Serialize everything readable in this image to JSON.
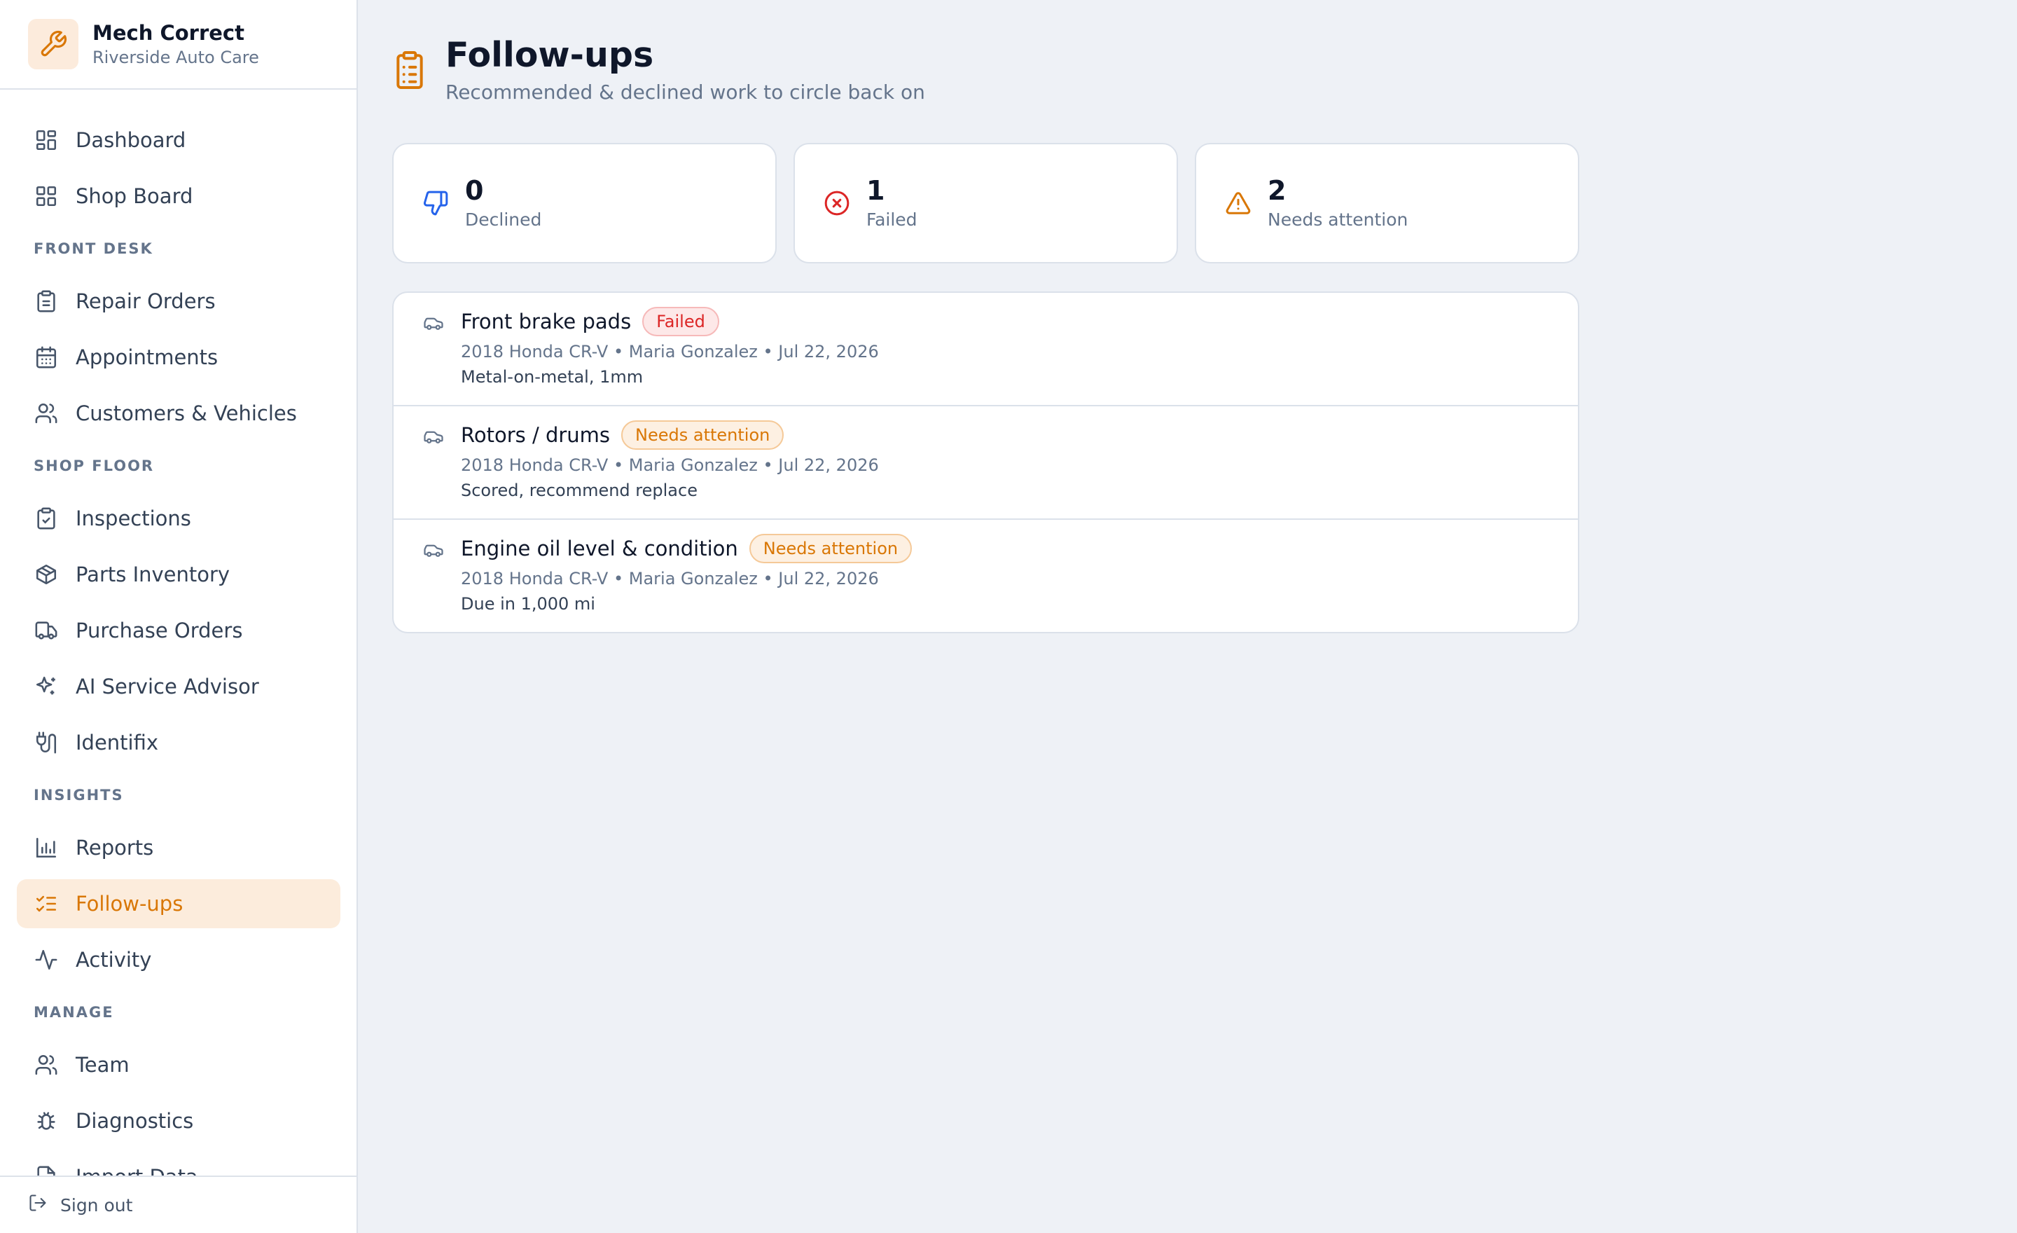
{
  "brand": {
    "name": "Mech Correct",
    "subtitle": "Riverside Auto Care",
    "icon": "wrench-icon"
  },
  "sidebar": {
    "items": [
      {
        "label": "Dashboard",
        "icon": "dashboard-icon"
      },
      {
        "label": "Shop Board",
        "icon": "grid-icon"
      },
      {
        "label": "Repair Orders",
        "icon": "clipboard-icon"
      },
      {
        "label": "Appointments",
        "icon": "calendar-icon"
      },
      {
        "label": "Customers & Vehicles",
        "icon": "users-icon"
      },
      {
        "label": "Inspections",
        "icon": "clipboard-check-icon"
      },
      {
        "label": "Parts Inventory",
        "icon": "package-icon"
      },
      {
        "label": "Purchase Orders",
        "icon": "truck-icon"
      },
      {
        "label": "AI Service Advisor",
        "icon": "sparkles-icon"
      },
      {
        "label": "Identifix",
        "icon": "plug-icon"
      },
      {
        "label": "Reports",
        "icon": "bar-chart-icon"
      },
      {
        "label": "Follow-ups",
        "icon": "list-checks-icon",
        "active": true
      },
      {
        "label": "Activity",
        "icon": "activity-icon"
      },
      {
        "label": "Team",
        "icon": "team-icon"
      },
      {
        "label": "Diagnostics",
        "icon": "bug-icon"
      },
      {
        "label": "Import Data",
        "icon": "file-import-icon"
      }
    ],
    "sections": [
      "FRONT DESK",
      "SHOP FLOOR",
      "INSIGHTS",
      "MANAGE"
    ],
    "signout": "Sign out"
  },
  "page": {
    "title": "Follow-ups",
    "subtitle": "Recommended & declined work to circle back on",
    "icon": "clipboard-list-icon"
  },
  "stats": [
    {
      "value": "0",
      "label": "Declined",
      "icon": "thumbs-down-icon",
      "color": "#2563eb"
    },
    {
      "value": "1",
      "label": "Failed",
      "icon": "x-circle-icon",
      "color": "#dc2626"
    },
    {
      "value": "2",
      "label": "Needs attention",
      "icon": "alert-triangle-icon",
      "color": "#d97706"
    }
  ],
  "followups": [
    {
      "title": "Front brake pads",
      "status": "Failed",
      "meta": "2018 Honda CR-V • Maria Gonzalez • Jul 22, 2026",
      "note": "Metal-on-metal, 1mm"
    },
    {
      "title": "Rotors / drums",
      "status": "Needs attention",
      "meta": "2018 Honda CR-V • Maria Gonzalez • Jul 22, 2026",
      "note": "Scored, recommend replace"
    },
    {
      "title": "Engine oil level & condition",
      "status": "Needs attention",
      "meta": "2018 Honda CR-V • Maria Gonzalez • Jul 22, 2026",
      "note": "Due in 1,000 mi"
    }
  ],
  "colors": {
    "accent": "#d97706",
    "active_bg": "#fcecdc",
    "failed": "#dc2626",
    "declined": "#2563eb"
  }
}
